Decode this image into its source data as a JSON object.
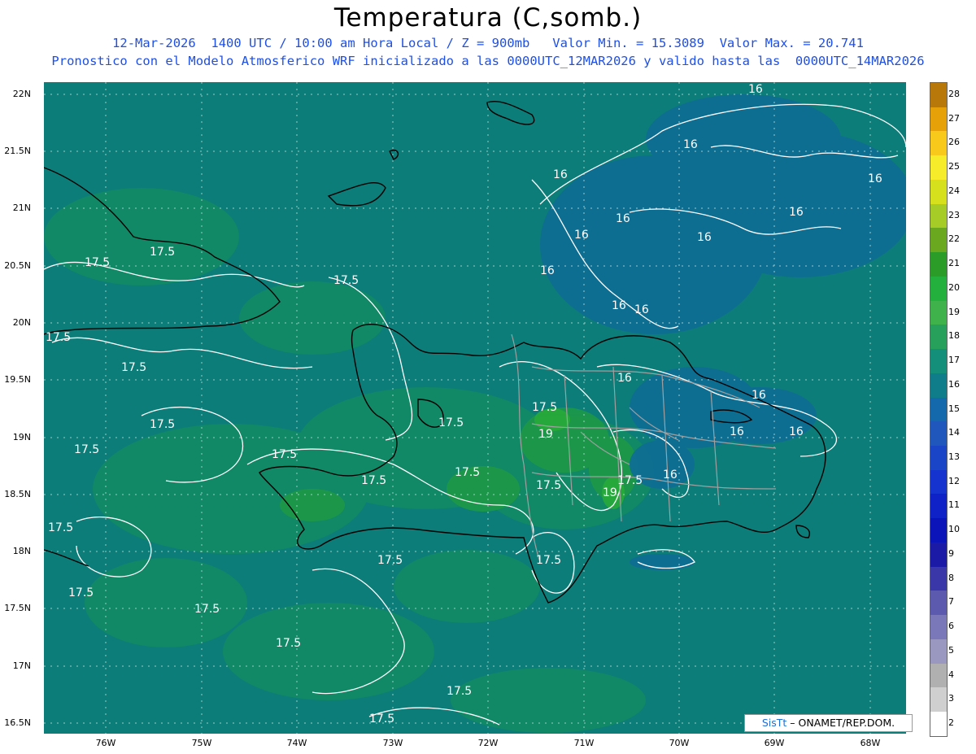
{
  "header": {
    "title": "Temperatura (C,somb.)",
    "subtitle": "12-Mar-2026  1400 UTC / 10:00 am Hora Local / Z = 900mb   Valor Min. = 15.3089  Valor Max. = 20.741",
    "subtitle2": "Pronostico con el Modelo Atmosferico WRF inicializado a las 0000UTC_12MAR2026 y valido hasta las  0000UTC_14MAR2026"
  },
  "axes": {
    "lat_labels": [
      "22N",
      "21.5N",
      "21N",
      "20.5N",
      "20N",
      "19.5N",
      "19N",
      "18.5N",
      "18N",
      "17.5N",
      "17N",
      "16.5N"
    ],
    "lon_labels": [
      "76W",
      "75W",
      "74W",
      "73W",
      "72W",
      "71W",
      "70W",
      "69W",
      "68W"
    ]
  },
  "colorbar": {
    "labels": [
      "28",
      "27",
      "26",
      "25",
      "24",
      "23",
      "22",
      "21",
      "20",
      "19",
      "18",
      "17",
      "16",
      "15",
      "14",
      "13",
      "12",
      "11",
      "10",
      "9",
      "8",
      "7",
      "6",
      "5",
      "4",
      "3",
      "2"
    ],
    "colors": [
      "#b8780a",
      "#e6a008",
      "#f8c81a",
      "#f7ec2a",
      "#d7e01c",
      "#a6cc28",
      "#6aa81f",
      "#2c9c28",
      "#24b03c",
      "#3fb24c",
      "#26a05a",
      "#14907a",
      "#0f7d8a",
      "#1468ac",
      "#2057bd",
      "#1a45c6",
      "#1533cf",
      "#0f22c8",
      "#0a14b8",
      "#1a1aa6",
      "#3a38a8",
      "#5c5aaf",
      "#7a78b8",
      "#9a97c0",
      "#b0b0b0",
      "#cfcfcf",
      "#ffffff"
    ]
  },
  "contour_labels": [
    "17.5",
    "16",
    "19"
  ],
  "credit": {
    "brand": "SisTt",
    "pi": "π",
    "org": "– ONAMET/REP.DOM."
  }
}
